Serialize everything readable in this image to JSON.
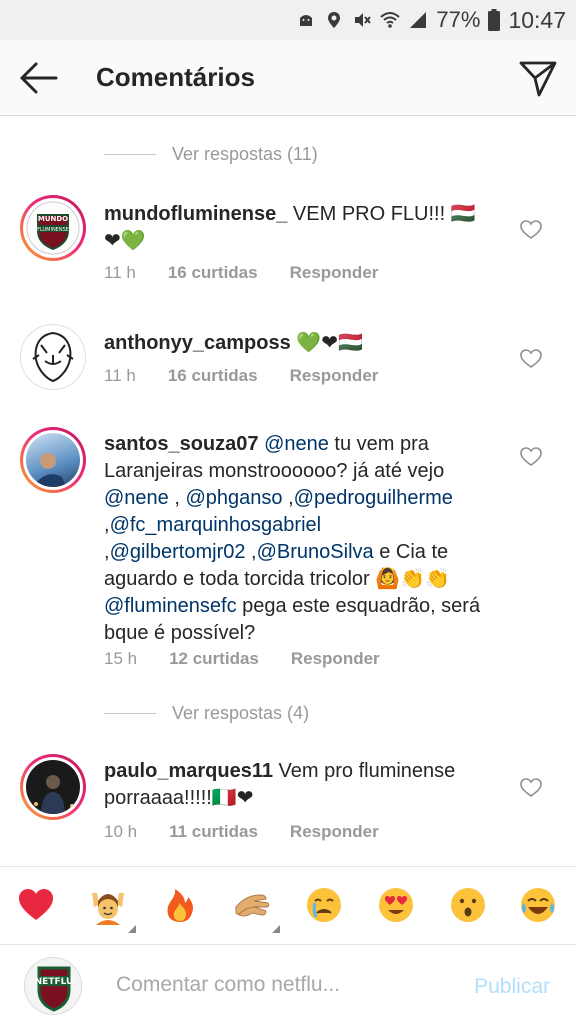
{
  "status_bar": {
    "battery": "77%",
    "time": "10:47"
  },
  "header": {
    "title": "Comentários"
  },
  "view_replies": [
    {
      "label": "Ver respostas (11)"
    },
    {
      "label": "Ver respostas (4)"
    }
  ],
  "comments": [
    {
      "username": "mundofluminense_",
      "text": "VEM PRO FLU!!!",
      "flag_emoji": "🇭🇺",
      "tail_emoji": "❤💚",
      "time": "11 h",
      "likes": "16 curtidas",
      "reply": "Responder"
    },
    {
      "username": "anthonyy_camposs",
      "text": "💚❤🇭🇺",
      "time": "11 h",
      "likes": "16 curtidas",
      "reply": "Responder"
    },
    {
      "username": "santos_souza07",
      "parts": {
        "m1": "@nene",
        "t1": " tu vem pra Laranjeiras monstroooooo? já até vejo ",
        "m2": "@nene",
        "t2": " , ",
        "m3": "@phganso",
        "t3": " ,",
        "m4": "@pedroguilherme",
        "t4": " ,",
        "m5": "@fc_marquinhosgabriel",
        "t5": " ,",
        "m6": "@gilbertomjr02",
        "t6": " ,",
        "m7": "@BrunoSilva",
        "t7": " e Cia te aguardo e toda torcida tricolor 🙆👏👏 ",
        "m8": "@fluminensefc",
        "t8": " pega este esquadrão, será bque é possível?"
      },
      "time": "15 h",
      "likes": "12 curtidas",
      "reply": "Responder"
    },
    {
      "username": "paulo_marques11",
      "text": "Vem pro fluminense porraaaa!!!!!🇮🇹❤",
      "time": "10 h",
      "likes": "11 curtidas",
      "reply": "Responder"
    }
  ],
  "emoji_bar": [
    "heart",
    "person-raising-hands",
    "fire",
    "clapping-hands",
    "crying-face",
    "heart-eyes-face",
    "surprised-face",
    "tears-of-joy-face"
  ],
  "avatar_texts": {
    "mundo_top": "MUNDO",
    "mundo_bottom": "FLUMINENSE",
    "netflu": "NETFLU"
  },
  "composer": {
    "placeholder": "Comentar como netflu...",
    "publish": "Publicar"
  },
  "colors": {
    "mention": "#003569",
    "meta": "#999999",
    "publish_disabled": "#b2dffc"
  }
}
